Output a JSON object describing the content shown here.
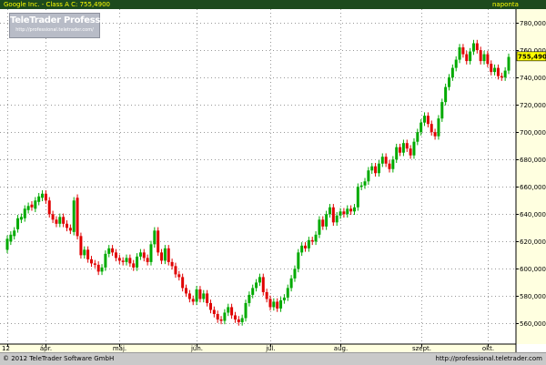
{
  "header": {
    "title": "Google Inc. - Class A C: 755,4900",
    "period": "naponta"
  },
  "logo": {
    "title": "TeleTrader Professional",
    "url": "http://professional.teletrader.com/"
  },
  "footer": {
    "copyright": "© 2012 TeleTrader Software GmbH",
    "url": "http://professional.teletrader.com"
  },
  "colors": {
    "background": "#ffffff",
    "axis_panel": "#ffffe0",
    "up_candle": "#00aa00",
    "down_candle": "#e00000",
    "price_label": "#ffff00",
    "grid": "#999999"
  },
  "chart_data": {
    "type": "candlestick",
    "title": "Google Inc. - Class A",
    "last_close": 755.49,
    "last_close_label": "755,4900",
    "ylim": [
      545,
      790
    ],
    "y_ticks": [
      560,
      580,
      600,
      620,
      640,
      660,
      680,
      700,
      720,
      740,
      760,
      780
    ],
    "y_tick_labels": [
      "560,0000",
      "580,0000",
      "600,0000",
      "620,0000",
      "640,0000",
      "660,0000",
      "680,0000",
      "700,0000",
      "720,0000",
      "740,0000",
      "760,0000",
      "780,0000"
    ],
    "x_months": [
      {
        "label": "12",
        "day": 0
      },
      {
        "label": "ápr.",
        "day": 11
      },
      {
        "label": "máj.",
        "day": 32
      },
      {
        "label": "jún.",
        "day": 54
      },
      {
        "label": "júl.",
        "day": 75
      },
      {
        "label": "aug.",
        "day": 95
      },
      {
        "label": "szept.",
        "day": 118
      },
      {
        "label": "okt.",
        "day": 137
      }
    ],
    "grid": true,
    "series": [
      {
        "values": [
          [
            0,
            614,
            622
          ],
          [
            1,
            620,
            625
          ],
          [
            2,
            624,
            628
          ],
          [
            3,
            629,
            637
          ],
          [
            4,
            636,
            638
          ],
          [
            5,
            637,
            644
          ],
          [
            6,
            643,
            646
          ],
          [
            7,
            647,
            645
          ],
          [
            8,
            644,
            650
          ],
          [
            9,
            649,
            653
          ],
          [
            10,
            652,
            655
          ],
          [
            11,
            655,
            650
          ],
          [
            12,
            650,
            640
          ],
          [
            13,
            640,
            636
          ],
          [
            14,
            636,
            633
          ],
          [
            15,
            633,
            638
          ],
          [
            16,
            638,
            633
          ],
          [
            17,
            633,
            630
          ],
          [
            18,
            630,
            628
          ],
          [
            19,
            627,
            650
          ],
          [
            20,
            652,
            624
          ],
          [
            21,
            624,
            610
          ],
          [
            22,
            610,
            614
          ],
          [
            23,
            614,
            607
          ],
          [
            24,
            607,
            604
          ],
          [
            25,
            604,
            603
          ],
          [
            26,
            603,
            598
          ],
          [
            27,
            598,
            601
          ],
          [
            28,
            601,
            611
          ],
          [
            29,
            611,
            615
          ],
          [
            30,
            615,
            612
          ],
          [
            31,
            612,
            608
          ],
          [
            32,
            608,
            606
          ],
          [
            33,
            606,
            605
          ],
          [
            34,
            605,
            608
          ],
          [
            35,
            608,
            604
          ],
          [
            36,
            604,
            601
          ],
          [
            37,
            601,
            609
          ],
          [
            38,
            609,
            612
          ],
          [
            39,
            612,
            608
          ],
          [
            40,
            608,
            605
          ],
          [
            41,
            605,
            618
          ],
          [
            42,
            618,
            628
          ],
          [
            43,
            628,
            612
          ],
          [
            44,
            612,
            606
          ],
          [
            45,
            606,
            615
          ],
          [
            46,
            615,
            605
          ],
          [
            47,
            605,
            602
          ],
          [
            48,
            602,
            596
          ],
          [
            49,
            596,
            594
          ],
          [
            50,
            594,
            586
          ],
          [
            51,
            586,
            582
          ],
          [
            52,
            582,
            578
          ],
          [
            53,
            578,
            576
          ],
          [
            54,
            576,
            585
          ],
          [
            55,
            585,
            578
          ],
          [
            56,
            578,
            582
          ],
          [
            57,
            582,
            575
          ],
          [
            58,
            575,
            570
          ],
          [
            59,
            570,
            567
          ],
          [
            60,
            567,
            563
          ],
          [
            61,
            563,
            562
          ],
          [
            62,
            562,
            568
          ],
          [
            63,
            568,
            572
          ],
          [
            64,
            572,
            566
          ],
          [
            65,
            566,
            563
          ],
          [
            66,
            563,
            561
          ],
          [
            67,
            561,
            564
          ],
          [
            68,
            564,
            575
          ],
          [
            69,
            575,
            581
          ],
          [
            70,
            581,
            586
          ],
          [
            71,
            586,
            590
          ],
          [
            72,
            590,
            594
          ],
          [
            73,
            594,
            583
          ],
          [
            74,
            583,
            578
          ],
          [
            75,
            578,
            572
          ],
          [
            76,
            572,
            576
          ],
          [
            77,
            576,
            571
          ],
          [
            78,
            571,
            577
          ],
          [
            79,
            577,
            579
          ],
          [
            80,
            579,
            586
          ],
          [
            81,
            586,
            593
          ],
          [
            82,
            593,
            600
          ],
          [
            83,
            600,
            612
          ],
          [
            84,
            612,
            617
          ],
          [
            85,
            617,
            615
          ],
          [
            86,
            615,
            621
          ],
          [
            87,
            621,
            620
          ],
          [
            88,
            620,
            625
          ],
          [
            89,
            625,
            636
          ],
          [
            90,
            636,
            631
          ],
          [
            91,
            631,
            640
          ],
          [
            92,
            640,
            645
          ],
          [
            93,
            645,
            634
          ],
          [
            94,
            634,
            639
          ],
          [
            95,
            639,
            642
          ],
          [
            96,
            642,
            640
          ],
          [
            97,
            640,
            644
          ],
          [
            98,
            644,
            642
          ],
          [
            99,
            642,
            645
          ],
          [
            100,
            645,
            660
          ],
          [
            101,
            660,
            661
          ],
          [
            102,
            661,
            664
          ],
          [
            103,
            664,
            672
          ],
          [
            104,
            672,
            675
          ],
          [
            105,
            675,
            670
          ],
          [
            106,
            670,
            677
          ],
          [
            107,
            677,
            682
          ],
          [
            108,
            682,
            677
          ],
          [
            109,
            677,
            673
          ],
          [
            110,
            673,
            680
          ],
          [
            111,
            680,
            689
          ],
          [
            112,
            689,
            685
          ],
          [
            113,
            685,
            692
          ],
          [
            114,
            692,
            688
          ],
          [
            115,
            688,
            683
          ],
          [
            116,
            683,
            693
          ],
          [
            117,
            693,
            700
          ],
          [
            118,
            700,
            707
          ],
          [
            119,
            707,
            712
          ],
          [
            120,
            712,
            706
          ],
          [
            121,
            706,
            700
          ],
          [
            122,
            700,
            697
          ],
          [
            123,
            697,
            710
          ],
          [
            124,
            710,
            722
          ],
          [
            125,
            722,
            733
          ],
          [
            126,
            733,
            740
          ],
          [
            127,
            740,
            747
          ],
          [
            128,
            747,
            753
          ],
          [
            129,
            753,
            762
          ],
          [
            130,
            762,
            757
          ],
          [
            131,
            757,
            752
          ],
          [
            132,
            752,
            759
          ],
          [
            133,
            759,
            765
          ],
          [
            134,
            765,
            760
          ],
          [
            135,
            760,
            752
          ],
          [
            136,
            752,
            757
          ],
          [
            137,
            757,
            750
          ],
          [
            138,
            750,
            744
          ],
          [
            139,
            744,
            747
          ],
          [
            140,
            747,
            741
          ],
          [
            141,
            741,
            740
          ],
          [
            142,
            740,
            745
          ],
          [
            143,
            745,
            755
          ]
        ]
      }
    ]
  }
}
